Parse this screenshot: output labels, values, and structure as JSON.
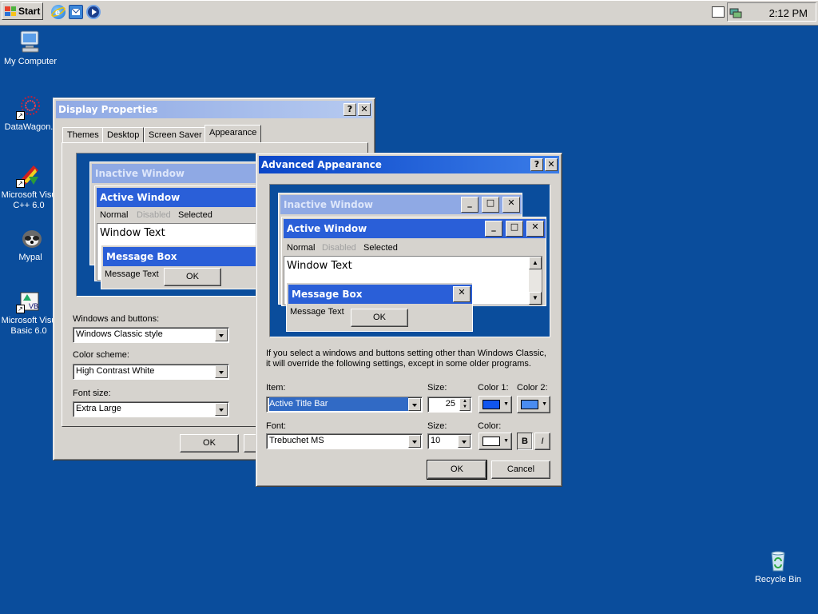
{
  "taskbar": {
    "start_label": "Start",
    "clock": "2:12 PM",
    "quick_launch": [
      "ie-icon",
      "outlook-icon",
      "media-player-icon"
    ]
  },
  "desktop": {
    "icons": [
      {
        "label": "My Computer",
        "icon": "my-computer-icon"
      },
      {
        "label": "DataWagon.",
        "icon": "datawagon-icon"
      },
      {
        "label": "Microsoft Visu C++ 6.0",
        "icon": "visual-cpp-icon"
      },
      {
        "label": "Mypal",
        "icon": "mypal-icon"
      },
      {
        "label": "Microsoft Visu Basic 6.0",
        "icon": "visual-basic-icon"
      },
      {
        "label": "Recycle Bin",
        "icon": "recycle-bin-icon"
      }
    ]
  },
  "display_properties": {
    "title": "Display Properties",
    "help": "?",
    "close": "✕",
    "tabs": [
      "Themes",
      "Desktop",
      "Screen Saver",
      "Appearance"
    ],
    "preview": {
      "inactive": "Inactive Window",
      "active": "Active Window",
      "menu": [
        "Normal",
        "Disabled",
        "Selected"
      ],
      "window_text": "Window Text",
      "message_box": "Message Box",
      "message_text": "Message Text",
      "ok": "OK"
    },
    "windows_buttons_label": "Windows and buttons:",
    "windows_buttons_value": "Windows Classic style",
    "color_scheme_label": "Color scheme:",
    "color_scheme_value": "High Contrast White",
    "font_size_label": "Font size:",
    "font_size_value": "Extra Large",
    "ok": "OK"
  },
  "advanced": {
    "title": "Advanced Appearance",
    "help": "?",
    "close": "✕",
    "preview": {
      "inactive": "Inactive Window",
      "active": "Active Window",
      "menu": [
        "Normal",
        "Disabled",
        "Selected"
      ],
      "window_text": "Window Text",
      "message_box": "Message Box",
      "message_text": "Message Text",
      "ok": "OK"
    },
    "info_line1": "If you select a windows and buttons setting other than Windows Classic,",
    "info_line2": "it will override the following settings, except in some older programs.",
    "item_label": "Item:",
    "item_value": "Active Title Bar",
    "size_label": "Size:",
    "size_value": "25",
    "color1_label": "Color 1:",
    "color2_label": "Color 2:",
    "font_label": "Font:",
    "font_value": "Trebuchet MS",
    "font_size_label": "Size:",
    "font_size_value": "10",
    "color_label": "Color:",
    "bold": "B",
    "italic": "I",
    "ok": "OK",
    "cancel": "Cancel"
  },
  "colors": {
    "desktop": "#0a4d9c",
    "active_title": "#2a5fd8",
    "inactive_title": "#8fa9e4",
    "color1": "#1155ee",
    "color2": "#4a8cf0"
  }
}
